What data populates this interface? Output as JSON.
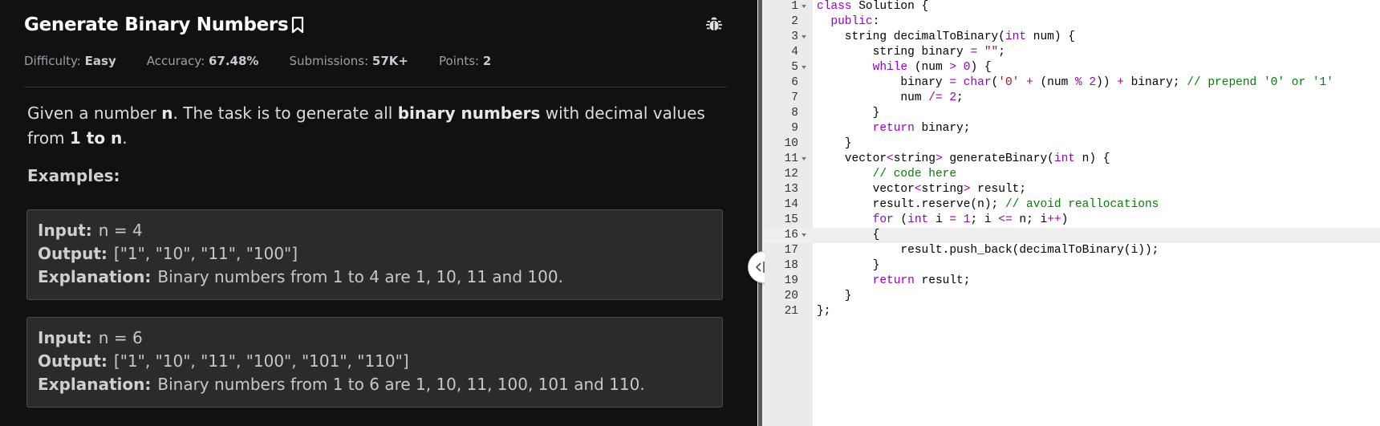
{
  "problem": {
    "title": "Generate Binary Numbers",
    "meta": [
      {
        "label": "Difficulty:",
        "value": "Easy"
      },
      {
        "label": "Accuracy:",
        "value": "67.48%"
      },
      {
        "label": "Submissions:",
        "value": "57K+"
      },
      {
        "label": "Points:",
        "value": "2"
      }
    ],
    "description": {
      "p1": "Given a number ",
      "b1": "n",
      "p2": ". The task is to generate all ",
      "b2": "binary numbers",
      "p3": " with decimal values from ",
      "b3": "1 to n",
      "p4": "."
    },
    "examples_heading": "Examples:",
    "examples": [
      {
        "input_label": "Input:",
        "input": "n = 4",
        "output_label": "Output:",
        "output": "[\"1\", \"10\", \"11\", \"100\"]",
        "explanation_label": "Explanation:",
        "explanation": "Binary numbers from 1 to 4 are 1, 10, 11 and 100."
      },
      {
        "input_label": "Input:",
        "input": "n = 6",
        "output_label": "Output:",
        "output": "[\"1\", \"10\", \"11\", \"100\", \"101\", \"110\"]",
        "explanation_label": "Explanation:",
        "explanation": "Binary numbers from 1 to 6 are 1, 10, 11, 100, 101 and 110."
      }
    ]
  },
  "icons": {
    "bookmark": "bookmark-icon",
    "bug": "bug-icon",
    "splitter": "resize-handle-icon"
  },
  "editor": {
    "active_line": 16,
    "line_numbers": [
      "1",
      "2",
      "3",
      "4",
      "5",
      "6",
      "7",
      "8",
      "9",
      "10",
      "11",
      "12",
      "13",
      "14",
      "15",
      "16",
      "17",
      "18",
      "19",
      "20",
      "21"
    ],
    "lines": [
      [
        {
          "t": "class ",
          "c": "kw2"
        },
        {
          "t": "Solution {"
        }
      ],
      [
        {
          "t": "  "
        },
        {
          "t": "public",
          "c": "kw2"
        },
        {
          "t": ":"
        }
      ],
      [
        {
          "t": "    string decimalToBinary("
        },
        {
          "t": "int",
          "c": "kw2"
        },
        {
          "t": " num) {"
        }
      ],
      [
        {
          "t": "        string binary "
        },
        {
          "t": "=",
          "c": "op"
        },
        {
          "t": " "
        },
        {
          "t": "\"\"",
          "c": "str"
        },
        {
          "t": ";"
        }
      ],
      [
        {
          "t": "        "
        },
        {
          "t": "while",
          "c": "kw2"
        },
        {
          "t": " (num "
        },
        {
          "t": ">",
          "c": "op"
        },
        {
          "t": " "
        },
        {
          "t": "0",
          "c": "kw2"
        },
        {
          "t": ") {"
        }
      ],
      [
        {
          "t": "            binary "
        },
        {
          "t": "=",
          "c": "op"
        },
        {
          "t": " "
        },
        {
          "t": "char",
          "c": "kw2"
        },
        {
          "t": "("
        },
        {
          "t": "'0'",
          "c": "str"
        },
        {
          "t": " "
        },
        {
          "t": "+",
          "c": "op"
        },
        {
          "t": " (num "
        },
        {
          "t": "%",
          "c": "op"
        },
        {
          "t": " "
        },
        {
          "t": "2",
          "c": "kw2"
        },
        {
          "t": ")) "
        },
        {
          "t": "+",
          "c": "op"
        },
        {
          "t": " binary; "
        },
        {
          "t": "// prepend '0' or '1'",
          "c": "cm"
        }
      ],
      [
        {
          "t": "            num "
        },
        {
          "t": "/=",
          "c": "op"
        },
        {
          "t": " "
        },
        {
          "t": "2",
          "c": "kw2"
        },
        {
          "t": ";"
        }
      ],
      [
        {
          "t": "        }"
        }
      ],
      [
        {
          "t": "        "
        },
        {
          "t": "return",
          "c": "kw2"
        },
        {
          "t": " binary;"
        }
      ],
      [
        {
          "t": "    }"
        }
      ],
      [
        {
          "t": "    vector"
        },
        {
          "t": "<",
          "c": "op"
        },
        {
          "t": "string"
        },
        {
          "t": ">",
          "c": "op"
        },
        {
          "t": " generateBinary("
        },
        {
          "t": "int",
          "c": "kw2"
        },
        {
          "t": " n) {"
        }
      ],
      [
        {
          "t": "        "
        },
        {
          "t": "// code here",
          "c": "cm"
        }
      ],
      [
        {
          "t": "        vector"
        },
        {
          "t": "<",
          "c": "op"
        },
        {
          "t": "string"
        },
        {
          "t": ">",
          "c": "op"
        },
        {
          "t": " result;"
        }
      ],
      [
        {
          "t": "        result.reserve(n); "
        },
        {
          "t": "// avoid reallocations",
          "c": "cm"
        }
      ],
      [
        {
          "t": "        "
        },
        {
          "t": "for",
          "c": "kw2"
        },
        {
          "t": " ("
        },
        {
          "t": "int",
          "c": "kw2"
        },
        {
          "t": " i "
        },
        {
          "t": "=",
          "c": "op"
        },
        {
          "t": " "
        },
        {
          "t": "1",
          "c": "kw2"
        },
        {
          "t": "; i "
        },
        {
          "t": "<=",
          "c": "op"
        },
        {
          "t": " n; i"
        },
        {
          "t": "++",
          "c": "op"
        },
        {
          "t": ")"
        }
      ],
      [
        {
          "t": "        {"
        }
      ],
      [
        {
          "t": "            result.push_back(decimalToBinary(i));"
        }
      ],
      [
        {
          "t": "        }"
        }
      ],
      [
        {
          "t": "        "
        },
        {
          "t": "return",
          "c": "kw2"
        },
        {
          "t": " result;"
        }
      ],
      [
        {
          "t": "    }"
        }
      ],
      [
        {
          "t": "};"
        }
      ]
    ]
  }
}
